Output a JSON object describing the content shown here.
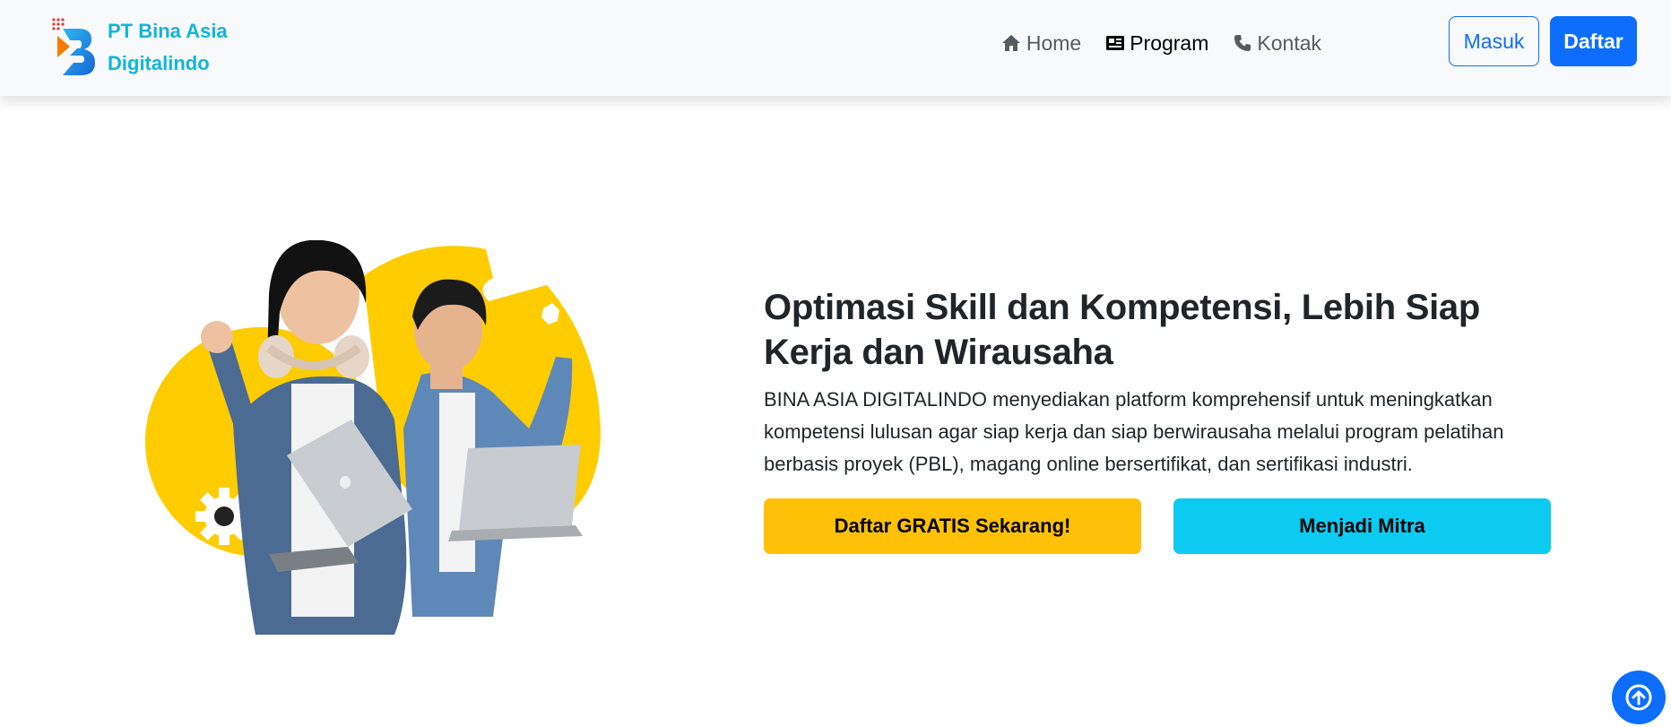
{
  "brand": {
    "name_line1": "PT Bina Asia",
    "name_line2": "Digitalindo",
    "logo_icon": "bina-asia-b-logo",
    "color": "#12b5d8"
  },
  "nav": {
    "items": [
      {
        "label": "Home",
        "icon": "home-icon",
        "active": false
      },
      {
        "label": "Program",
        "icon": "newspaper-icon",
        "active": true
      },
      {
        "label": "Kontak",
        "icon": "phone-icon",
        "active": false
      }
    ],
    "login_label": "Masuk",
    "register_label": "Daftar"
  },
  "hero": {
    "title": "Optimasi Skill dan Kompetensi, Lebih Siap Kerja dan Wirausaha",
    "description": "BINA ASIA DIGITALINDO menyediakan platform komprehensif untuk meningkatkan kompetensi lulusan agar siap kerja dan siap berwirausaha melalui program pelatihan berbasis proyek (PBL), magang online bersertifikat, dan sertifikasi industri.",
    "cta_primary": "Daftar GRATIS Sekarang!",
    "cta_secondary": "Menjadi Mitra",
    "image": "two-students-with-laptops-illustration"
  },
  "back_to_top": {
    "icon": "arrow-up-circle-icon"
  },
  "colors": {
    "primary": "#0d6efd",
    "warning": "#ffc107",
    "info": "#0dcaf0",
    "accent_yellow": "#ffcc00"
  }
}
